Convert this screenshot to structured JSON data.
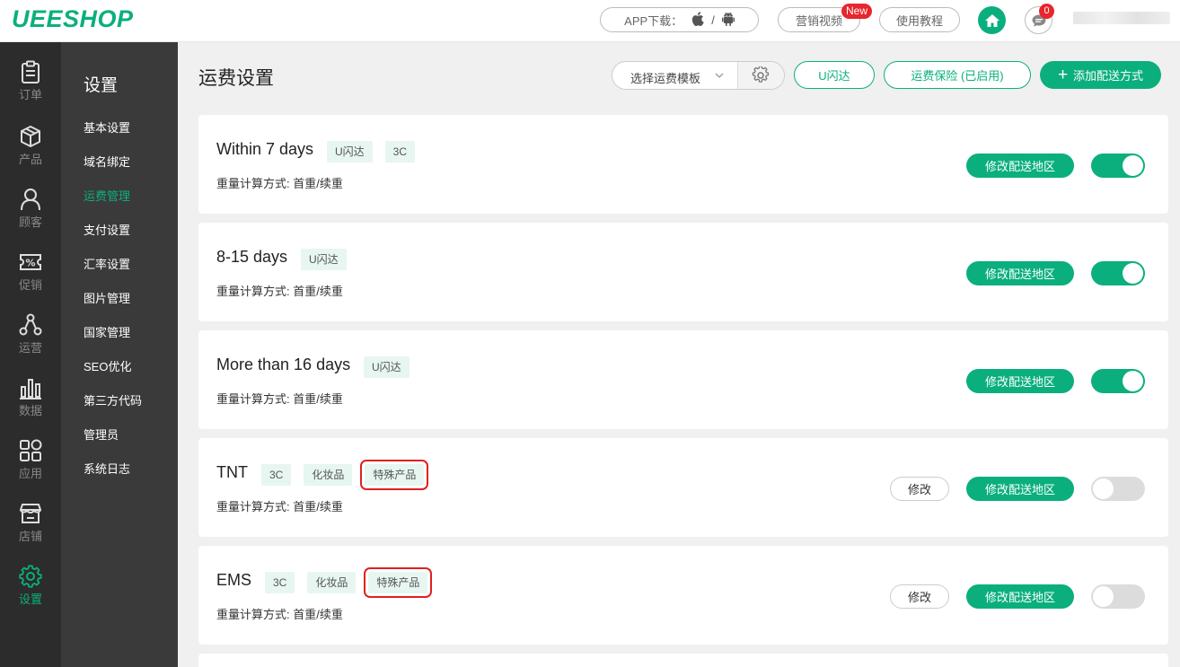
{
  "header": {
    "logo": "UEESHOP",
    "app_download": "APP下载：",
    "app_sep": "/",
    "video": "营销视频",
    "new_badge": "New",
    "tutorial": "使用教程",
    "message_count": "0"
  },
  "leftnav": [
    {
      "label": "订单",
      "icon": "clipboard-icon"
    },
    {
      "label": "产品",
      "icon": "box-icon"
    },
    {
      "label": "顾客",
      "icon": "user-icon"
    },
    {
      "label": "促销",
      "icon": "percent-ticket-icon"
    },
    {
      "label": "运营",
      "icon": "network-icon"
    },
    {
      "label": "数据",
      "icon": "bar-chart-icon"
    },
    {
      "label": "应用",
      "icon": "apps-icon"
    },
    {
      "label": "店铺",
      "icon": "store-icon"
    },
    {
      "label": "设置",
      "icon": "gear-icon",
      "active": true
    }
  ],
  "subnav": {
    "title": "设置",
    "items": [
      "基本设置",
      "域名绑定",
      "运费管理",
      "支付设置",
      "汇率设置",
      "图片管理",
      "国家管理",
      "SEO优化",
      "第三方代码",
      "管理员",
      "系统日志"
    ],
    "active_index": 2
  },
  "main": {
    "title": "运费设置",
    "template_select": "选择运费模板",
    "u_button": "U闪达",
    "insurance_button": "运费保险 (已启用)",
    "add_button": "添加配送方式",
    "region_label": "修改配送地区",
    "edit_label": "修改",
    "cards": [
      {
        "name": "Within 7 days",
        "tags": [
          "U闪达",
          "3C"
        ],
        "sub": "重量计算方式: 首重/续重",
        "enabled": true,
        "editable": false,
        "highlight_tag": -1
      },
      {
        "name": "8-15 days",
        "tags": [
          "U闪达"
        ],
        "sub": "重量计算方式: 首重/续重",
        "enabled": true,
        "editable": false,
        "highlight_tag": -1
      },
      {
        "name": "More than 16 days",
        "tags": [
          "U闪达"
        ],
        "sub": "重量计算方式: 首重/续重",
        "enabled": true,
        "editable": false,
        "highlight_tag": -1
      },
      {
        "name": "TNT",
        "tags": [
          "3C",
          "化妆品",
          "特殊产品"
        ],
        "sub": "重量计算方式: 首重/续重",
        "enabled": false,
        "editable": true,
        "highlight_tag": 2
      },
      {
        "name": "EMS",
        "tags": [
          "3C",
          "化妆品",
          "特殊产品"
        ],
        "sub": "重量计算方式: 首重/续重",
        "enabled": false,
        "editable": true,
        "highlight_tag": 2
      }
    ]
  },
  "colors": {
    "accent": "#0baf7d",
    "alert": "#e8262d",
    "highlight_border": "#e02020",
    "nav_bg": "#2c2c2c",
    "subnav_bg": "#3a3a3a"
  }
}
